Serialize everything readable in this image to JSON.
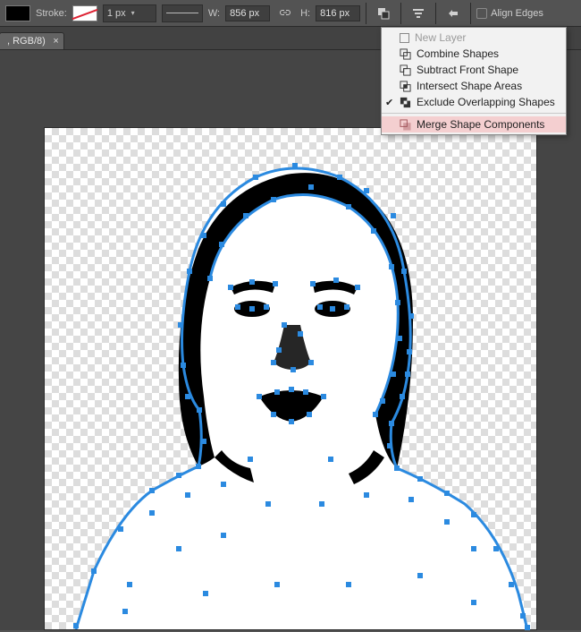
{
  "toolbar": {
    "stroke_label": "Stroke:",
    "stroke_width_value": "1 px",
    "width_label": "W:",
    "width_value": "856 px",
    "height_label": "H:",
    "height_value": "816 px",
    "align_edges_label": "Align Edges"
  },
  "tab": {
    "title": ", RGB/8)"
  },
  "menu": {
    "items": [
      {
        "id": "new",
        "label": "New Layer",
        "enabled": false
      },
      {
        "id": "combine",
        "label": "Combine Shapes",
        "enabled": true
      },
      {
        "id": "subtract",
        "label": "Subtract Front Shape",
        "enabled": true
      },
      {
        "id": "intersect",
        "label": "Intersect Shape Areas",
        "enabled": true
      },
      {
        "id": "exclude",
        "label": "Exclude Overlapping Shapes",
        "enabled": true,
        "checked": true
      },
      {
        "id": "merge",
        "label": "Merge Shape Components",
        "enabled": true,
        "highlight": true
      }
    ]
  },
  "colors": {
    "node": "#2b8ae0",
    "highlight_menu": "#f4cfd0"
  }
}
